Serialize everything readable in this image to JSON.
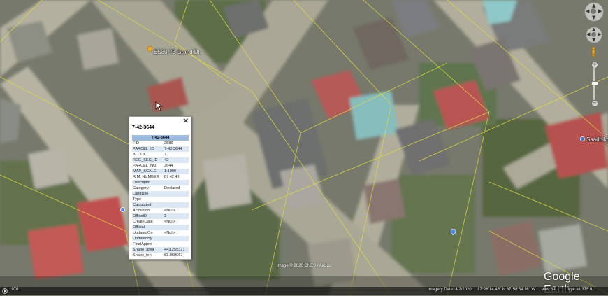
{
  "map": {
    "place_labels": [
      "ES30-75 Grand Dr",
      "Saadhikoe Stree"
    ],
    "imagery_credit": "Image © 2020 CNES / Airbus",
    "logo": "Google Earth",
    "icons": [
      "place-pin-icon",
      "location-pin-icon",
      "hand-cursor-icon"
    ]
  },
  "controls": {
    "icons": [
      "look-around-icon",
      "move-icon",
      "pegman-icon",
      "zoom-in-icon",
      "zoom-out-icon"
    ],
    "zoom_in": "+",
    "zoom_out": "−"
  },
  "balloon": {
    "title": "7-42-3644",
    "close": "✕",
    "table_header": "7-42-3644",
    "rows": [
      {
        "key": "FID",
        "value": "2586"
      },
      {
        "key": "PARCEL_ID",
        "value": "7-42-3644"
      },
      {
        "key": "BLOCK",
        "value": "7"
      },
      {
        "key": "REG_SEC_ID",
        "value": "42"
      },
      {
        "key": "PARCEL_NO",
        "value": "3644"
      },
      {
        "key": "MAP_SCALE",
        "value": "1:1000"
      },
      {
        "key": "RIM_NUMBER",
        "value": "07 42 42"
      },
      {
        "key": "Descriptio",
        "value": ""
      },
      {
        "key": "Category",
        "value": "Declared"
      },
      {
        "key": "LandUse",
        "value": ""
      },
      {
        "key": "Type",
        "value": ""
      },
      {
        "key": "Calculated",
        "value": ""
      },
      {
        "key": "Activation",
        "value": "<Null>"
      },
      {
        "key": "OfficeID",
        "value": "3"
      },
      {
        "key": "CreateDate",
        "value": "<Null>"
      },
      {
        "key": "Official",
        "value": ""
      },
      {
        "key": "UpdatedOn",
        "value": "<Null>"
      },
      {
        "key": "UpdatedBy",
        "value": ""
      },
      {
        "key": "FinalAppro",
        "value": ""
      },
      {
        "key": "Shape_area",
        "value": "443.255321"
      },
      {
        "key": "Shape_len",
        "value": "83.069067"
      }
    ]
  },
  "status_bar": {
    "tour_icon": "tour-icon",
    "left_text": "1970",
    "imagery_date": "Imagery Date: 4/2/2020",
    "coordinates": "17°28'14.45\" N  87°58'54.16\" W",
    "elevation": "elev   8 ft",
    "eye_alt": "eye alt   375 ft"
  },
  "colors": {
    "ground": "#7d7f6f",
    "roof_red": "#b8504f",
    "roof_gray": "#6e6f6d",
    "parcel_line": "#e4de3a",
    "table_header": "#9cb9e0",
    "table_alt_row": "#dde8f6"
  }
}
